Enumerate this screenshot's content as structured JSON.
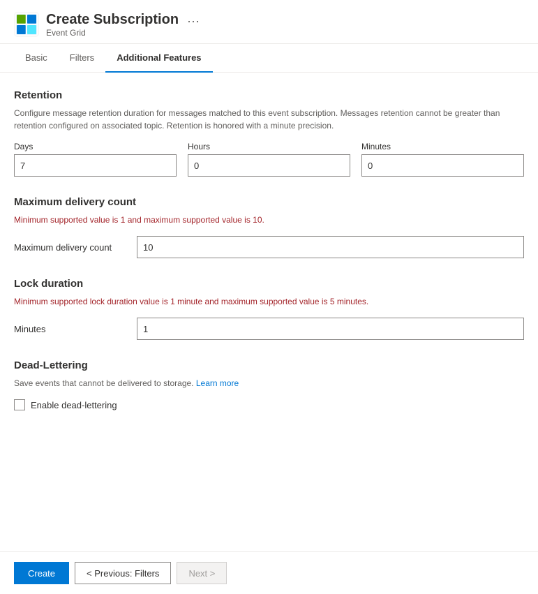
{
  "header": {
    "title": "Create Subscription",
    "subtitle": "Event Grid",
    "more_icon": "···"
  },
  "tabs": [
    {
      "id": "basic",
      "label": "Basic",
      "active": false
    },
    {
      "id": "filters",
      "label": "Filters",
      "active": false
    },
    {
      "id": "additional-features",
      "label": "Additional Features",
      "active": true
    }
  ],
  "sections": {
    "retention": {
      "title": "Retention",
      "description": "Configure message retention duration for messages matched to this event subscription. Messages retention cannot be greater than retention configured on associated topic. Retention is honored with a minute precision.",
      "days_label": "Days",
      "days_value": "7",
      "hours_label": "Hours",
      "hours_value": "0",
      "minutes_label": "Minutes",
      "minutes_value": "0"
    },
    "max_delivery": {
      "title": "Maximum delivery count",
      "warning": "Minimum supported value is 1 and maximum supported value is 10.",
      "label": "Maximum delivery count",
      "value": "10"
    },
    "lock_duration": {
      "title": "Lock duration",
      "warning": "Minimum supported lock duration value is 1 minute and maximum supported value is 5 minutes.",
      "label": "Minutes",
      "value": "1"
    },
    "dead_lettering": {
      "title": "Dead-Lettering",
      "description": "Save events that cannot be delivered to storage.",
      "learn_more_label": "Learn more",
      "checkbox_label": "Enable dead-lettering",
      "checkbox_checked": false
    }
  },
  "footer": {
    "create_label": "Create",
    "previous_label": "< Previous: Filters",
    "next_label": "Next >"
  }
}
